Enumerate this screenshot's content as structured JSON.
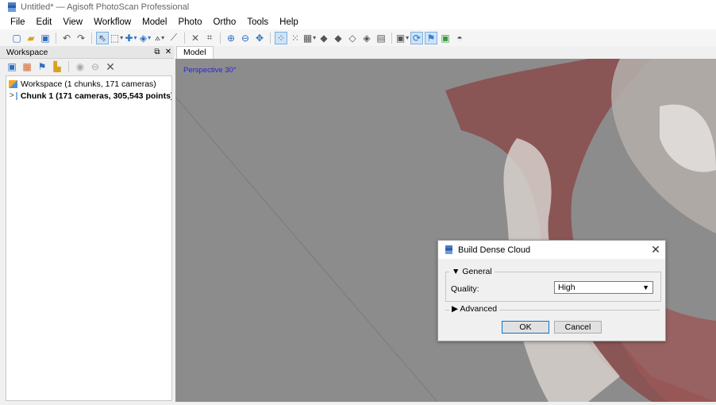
{
  "window": {
    "title": "Untitled* — Agisoft PhotoScan Professional"
  },
  "menu": [
    "File",
    "Edit",
    "View",
    "Workflow",
    "Model",
    "Photo",
    "Ortho",
    "Tools",
    "Help"
  ],
  "toolbar": {
    "icons": [
      "new-icon",
      "open-icon",
      "save-icon",
      "undo-icon",
      "redo-icon",
      "select-icon",
      "rect-select-icon",
      "navigate-icon",
      "rotate-object-icon",
      "ruler-icon",
      "draw-icon",
      "delete-icon",
      "crop-icon",
      "zoom-in-icon",
      "zoom-out-icon",
      "move-icon",
      "points-icon",
      "dense-icon",
      "tiled-icon",
      "shaded-icon",
      "solid-icon",
      "wireframe-icon",
      "textured-icon",
      "dem-icon",
      "cameras-icon",
      "show-cameras-icon",
      "markers-icon",
      "region-icon",
      "trackball-icon"
    ]
  },
  "workspace": {
    "title": "Workspace",
    "root": "Workspace (1 chunks, 171 cameras)",
    "chunk": "Chunk 1 (171 cameras, 305,543 points)"
  },
  "model_tab": {
    "label": "Model",
    "view_label": "Perspective 30°"
  },
  "dialog": {
    "title": "Build Dense Cloud",
    "general_label": "General",
    "quality_label": "Quality:",
    "quality_value": "High",
    "advanced_label": "Advanced",
    "ok_label": "OK",
    "cancel_label": "Cancel"
  },
  "colors": {
    "viewport_bg": "#8c8c8c",
    "accent": "#0078d7",
    "view_label": "#2424d8"
  }
}
